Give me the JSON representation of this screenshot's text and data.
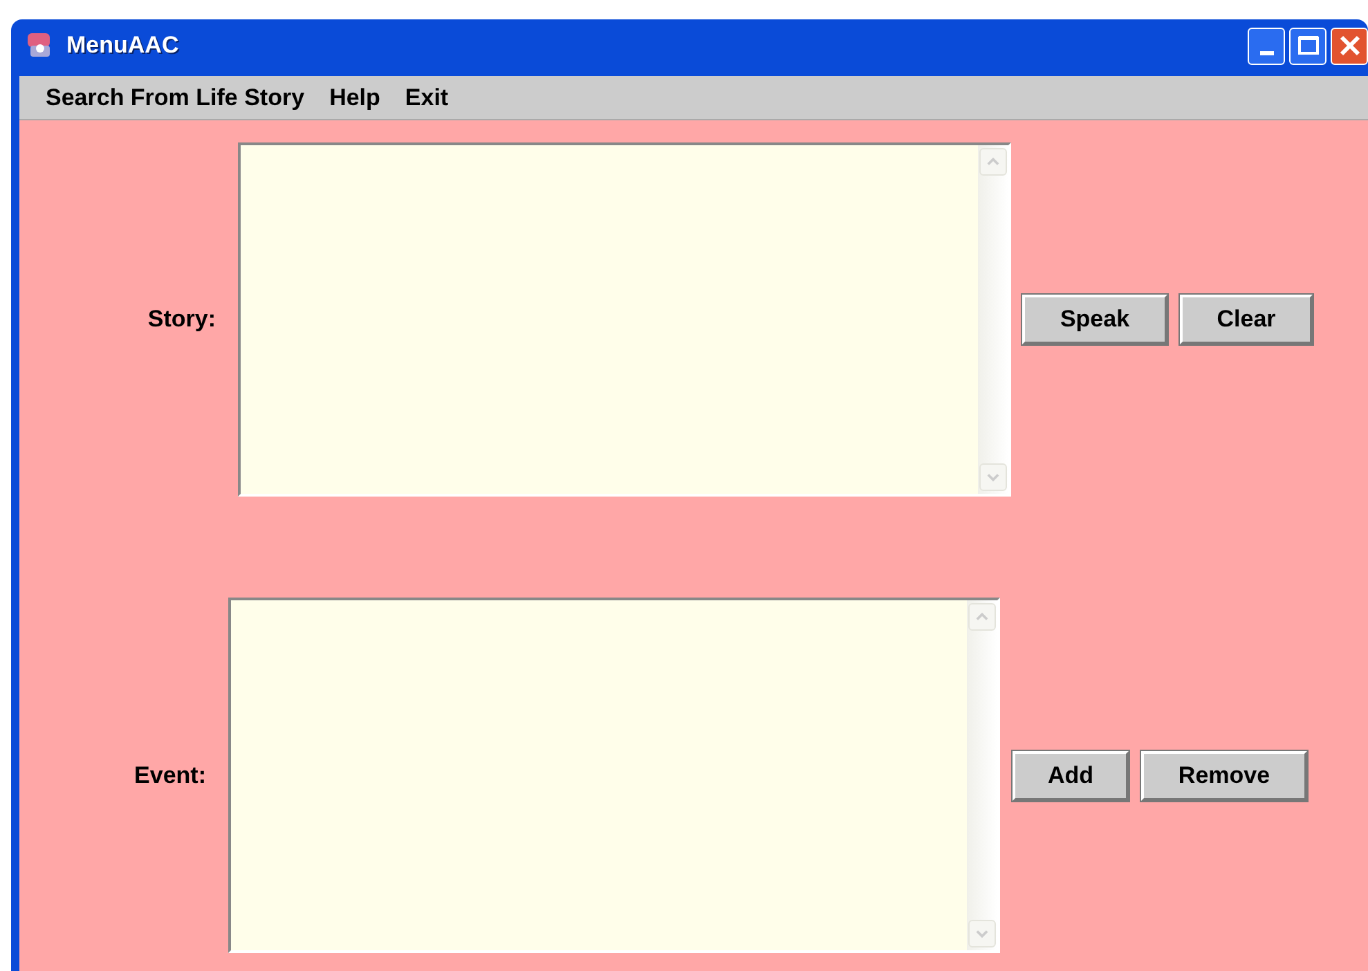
{
  "window": {
    "title": "MenuAAC"
  },
  "menu": [
    "Search From Life Story",
    "Help",
    "Exit"
  ],
  "sections": [
    {
      "label": "Story:",
      "buttons": [
        "Speak",
        "Clear"
      ]
    },
    {
      "label": "Event:",
      "buttons": [
        "Add",
        "Remove"
      ]
    }
  ]
}
